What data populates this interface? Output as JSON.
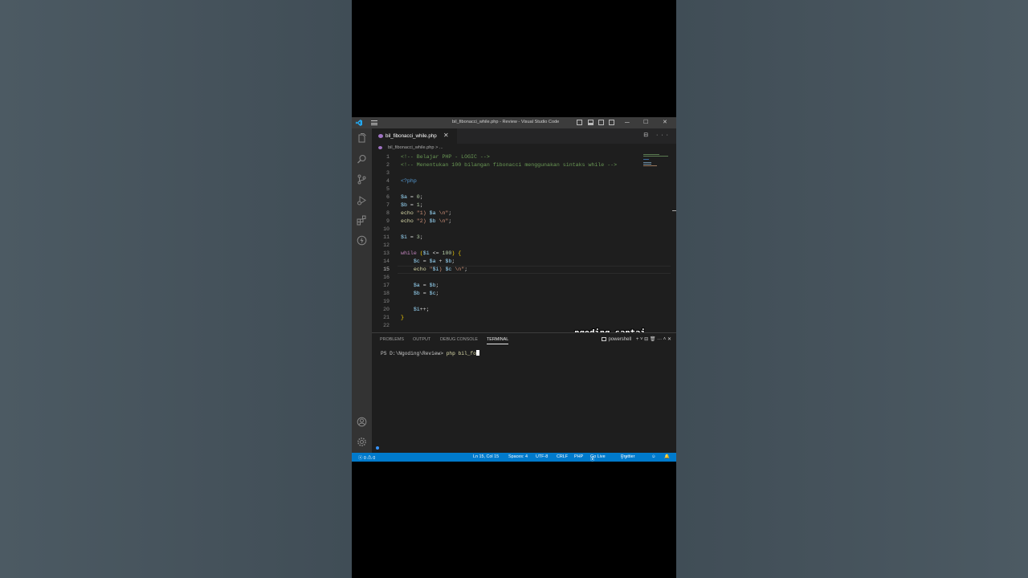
{
  "window": {
    "title": "bil_fibonacci_while.php - Review - Visual Studio Code",
    "minimize": "─",
    "maximize": "☐",
    "close": "✕"
  },
  "tab": {
    "name": "bil_fibonacci_while.php",
    "close": "✕"
  },
  "tab_actions": "⊟ ···",
  "breadcrumb": "bil_fibonacci_while.php > ...",
  "code_lines": [
    {
      "n": "1",
      "segs": [
        [
          "c-com",
          "<!-- Belajar PHP - LOGIC -->"
        ]
      ]
    },
    {
      "n": "2",
      "segs": [
        [
          "c-com",
          "<!-- Menentukan 100 bilangan fibonacci menggunakan sintaks while -->"
        ]
      ]
    },
    {
      "n": "3",
      "segs": []
    },
    {
      "n": "4",
      "segs": [
        [
          "c-tag",
          "<?php"
        ]
      ]
    },
    {
      "n": "5",
      "segs": []
    },
    {
      "n": "6",
      "segs": [
        [
          "c-var",
          "$a"
        ],
        [
          "c-op",
          " = "
        ],
        [
          "c-num",
          "0"
        ],
        [
          "c-op",
          ";"
        ]
      ]
    },
    {
      "n": "7",
      "segs": [
        [
          "c-var",
          "$b"
        ],
        [
          "c-op",
          " = "
        ],
        [
          "c-num",
          "1"
        ],
        [
          "c-op",
          ";"
        ]
      ]
    },
    {
      "n": "8",
      "segs": [
        [
          "c-fn",
          "echo"
        ],
        [
          "c-op",
          " "
        ],
        [
          "c-str",
          "\"1) "
        ],
        [
          "c-var",
          "$a"
        ],
        [
          "c-str",
          " \\n\""
        ],
        [
          "c-op",
          ";"
        ]
      ]
    },
    {
      "n": "9",
      "segs": [
        [
          "c-fn",
          "echo"
        ],
        [
          "c-op",
          " "
        ],
        [
          "c-str",
          "\"2) "
        ],
        [
          "c-var",
          "$b"
        ],
        [
          "c-str",
          " \\n\""
        ],
        [
          "c-op",
          ";"
        ]
      ]
    },
    {
      "n": "10",
      "segs": []
    },
    {
      "n": "11",
      "segs": [
        [
          "c-var",
          "$i"
        ],
        [
          "c-op",
          " = "
        ],
        [
          "c-num",
          "3"
        ],
        [
          "c-op",
          ";"
        ]
      ]
    },
    {
      "n": "12",
      "segs": []
    },
    {
      "n": "13",
      "segs": [
        [
          "c-kw",
          "while"
        ],
        [
          "c-op",
          " "
        ],
        [
          "c-br",
          "("
        ],
        [
          "c-var",
          "$i"
        ],
        [
          "c-op",
          " <= "
        ],
        [
          "c-num",
          "100"
        ],
        [
          "c-br",
          ")"
        ],
        [
          "c-op",
          " "
        ],
        [
          "c-br",
          "{"
        ]
      ]
    },
    {
      "n": "14",
      "segs": [
        [
          "c-op",
          "    "
        ],
        [
          "c-var",
          "$c"
        ],
        [
          "c-op",
          " = "
        ],
        [
          "c-var",
          "$a"
        ],
        [
          "c-op",
          " + "
        ],
        [
          "c-var",
          "$b"
        ],
        [
          "c-op",
          ";"
        ]
      ]
    },
    {
      "n": "15",
      "segs": [
        [
          "c-op",
          "    "
        ],
        [
          "c-fn",
          "echo"
        ],
        [
          "c-op",
          " "
        ],
        [
          "c-str",
          "\""
        ],
        [
          "c-var",
          "$i"
        ],
        [
          "c-str",
          ") "
        ],
        [
          "c-var",
          "$c"
        ],
        [
          "c-str",
          " \\n\""
        ],
        [
          "c-op",
          ";"
        ]
      ]
    },
    {
      "n": "16",
      "segs": []
    },
    {
      "n": "17",
      "segs": [
        [
          "c-op",
          "    "
        ],
        [
          "c-var",
          "$a"
        ],
        [
          "c-op",
          " = "
        ],
        [
          "c-var",
          "$b"
        ],
        [
          "c-op",
          ";"
        ]
      ]
    },
    {
      "n": "18",
      "segs": [
        [
          "c-op",
          "    "
        ],
        [
          "c-var",
          "$b"
        ],
        [
          "c-op",
          " = "
        ],
        [
          "c-var",
          "$c"
        ],
        [
          "c-op",
          ";"
        ]
      ]
    },
    {
      "n": "19",
      "segs": []
    },
    {
      "n": "20",
      "segs": [
        [
          "c-op",
          "    "
        ],
        [
          "c-var",
          "$i"
        ],
        [
          "c-op",
          "++;"
        ]
      ]
    },
    {
      "n": "21",
      "segs": [
        [
          "c-br",
          "}"
        ]
      ]
    },
    {
      "n": "22",
      "segs": []
    }
  ],
  "current_line": "15",
  "watermark": "ngoding_santai",
  "panel": {
    "tabs": [
      "PROBLEMS",
      "OUTPUT",
      "DEBUG CONSOLE",
      "TERMINAL"
    ],
    "active_tab": "TERMINAL",
    "shell": "powershell",
    "actions": "+ ˅  ⊟  🗑  ···  ˄  ✕"
  },
  "terminal": {
    "prompt": "PS D:\\Ngoding\\Review> ",
    "command": "php bil_fo"
  },
  "status": {
    "problems": "ⓧ 0 ⚠ 0",
    "position": "Ln 15, Col 15",
    "spaces": "Spaces: 4",
    "encoding": "UTF-8",
    "eol": "CRLF",
    "language": "PHP",
    "golive": "Go Live",
    "prettier": "Prettier"
  },
  "colors": {
    "accent": "#007acc",
    "editor_bg": "#1e1e1e",
    "titlebar": "#3c3c3c",
    "activity": "#333333"
  }
}
